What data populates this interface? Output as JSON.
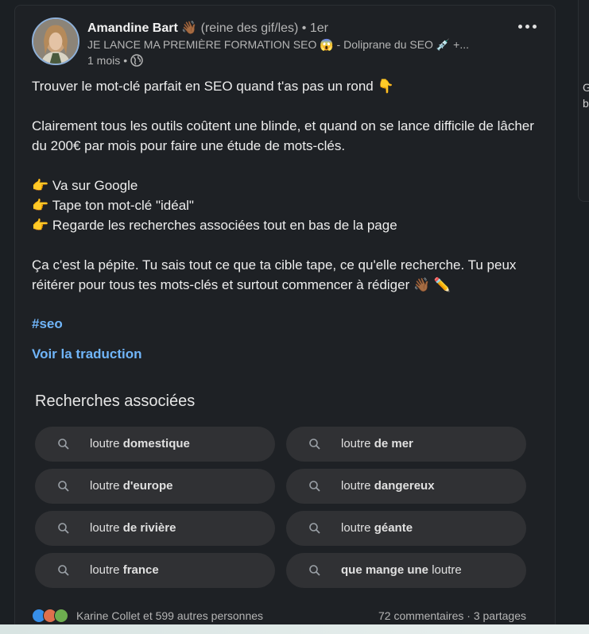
{
  "author": {
    "name": "Amandine Bart",
    "name_emoji": "👋🏾",
    "tag": "(reine des gif/les)",
    "separator": "•",
    "degree": "1er",
    "headline": "JE LANCE MA PREMIÈRE FORMATION SEO 😱 - Doliprane du SEO 💉 +...",
    "time": "1 mois",
    "visibility_icon": "globe-icon"
  },
  "post": {
    "paragraphs": [
      "Trouver le mot-clé parfait en SEO quand t'as pas un rond 👇",
      "Clairement tous les outils coûtent une blinde, et quand on se lance difficile de lâcher du 200€ par mois pour faire une étude de mots-clés.",
      "👉 Va sur Google\n👉 Tape ton mot-clé \"idéal\"\n👉 Regarde les recherches associées tout en bas de la page",
      "Ça c'est la pépite. Tu sais tout ce que ta cible tape, ce qu'elle recherche. Tu peux réitérer pour tous tes mots-clés et surtout commencer à rédiger 👋🏾 ✏️"
    ],
    "hashtag": "#seo",
    "translate_link": "Voir la traduction"
  },
  "related_searches": {
    "title": "Recherches associées",
    "chips": [
      {
        "prefix": "loutre ",
        "bold": "domestique",
        "suffix": ""
      },
      {
        "prefix": "loutre ",
        "bold": "de mer",
        "suffix": ""
      },
      {
        "prefix": "loutre ",
        "bold": "d'europe",
        "suffix": ""
      },
      {
        "prefix": "loutre ",
        "bold": "dangereux",
        "suffix": ""
      },
      {
        "prefix": "loutre ",
        "bold": "de rivière",
        "suffix": ""
      },
      {
        "prefix": "loutre ",
        "bold": "géante",
        "suffix": ""
      },
      {
        "prefix": "loutre ",
        "bold": "france",
        "suffix": ""
      },
      {
        "prefix": "",
        "bold": "que mange une",
        "suffix": " loutre"
      }
    ]
  },
  "footer": {
    "reactions_text": "Karine Collet et 599 autres personnes",
    "comments": "72 commentaires",
    "dot": "·",
    "shares": "3 partages"
  },
  "sidebar": {
    "line1": "G",
    "line2": "b"
  }
}
